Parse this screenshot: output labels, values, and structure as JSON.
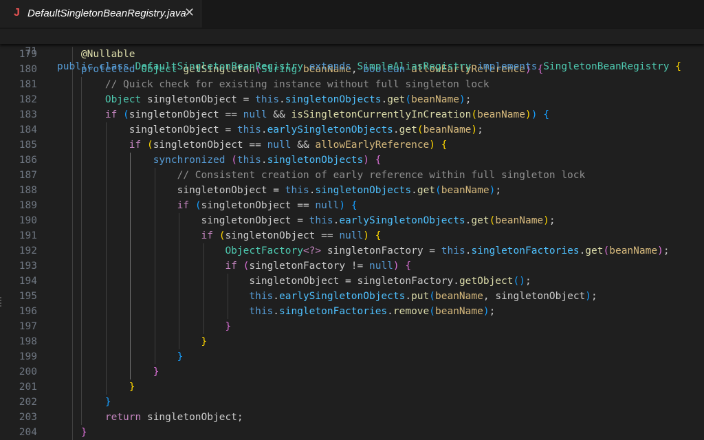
{
  "tab": {
    "icon": "J",
    "icon_color": "#e55353",
    "filename": "DefaultSingletonBeanRegistry.java",
    "close_glyph": "✕"
  },
  "sticky": {
    "line_no": "71",
    "tokens": [
      [
        "kw",
        "public"
      ],
      [
        "op",
        " "
      ],
      [
        "kw",
        "class"
      ],
      [
        "op",
        " "
      ],
      [
        "ty",
        "DefaultSingletonBeanRegistry"
      ],
      [
        "op",
        " "
      ],
      [
        "kw",
        "extends"
      ],
      [
        "op",
        " "
      ],
      [
        "ty",
        "SimpleAliasRegistry"
      ],
      [
        "op",
        " "
      ],
      [
        "kw",
        "implements"
      ],
      [
        "op",
        " "
      ],
      [
        "ty",
        "SingletonBeanRegistry"
      ],
      [
        "op",
        " "
      ],
      [
        "pal1",
        "{"
      ]
    ]
  },
  "lines": [
    {
      "n": "179",
      "t": [
        [
          "op",
          "    "
        ],
        [
          "an",
          "@Nullable"
        ]
      ]
    },
    {
      "n": "180",
      "t": [
        [
          "op",
          "    "
        ],
        [
          "kw",
          "protected"
        ],
        [
          "op",
          " "
        ],
        [
          "ty",
          "Object"
        ],
        [
          "op",
          " "
        ],
        [
          "fn",
          "getSingleton"
        ],
        [
          "pal2",
          "("
        ],
        [
          "ty",
          "String"
        ],
        [
          "op",
          " "
        ],
        [
          "par",
          "beanName"
        ],
        [
          "op",
          ", "
        ],
        [
          "kw",
          "boolean"
        ],
        [
          "op",
          " "
        ],
        [
          "par",
          "allowEarlyReference"
        ],
        [
          "pal2",
          ")"
        ],
        [
          "op",
          " "
        ],
        [
          "pal2",
          "{"
        ]
      ]
    },
    {
      "n": "181",
      "t": [
        [
          "op",
          "        "
        ],
        [
          "cm",
          "// Quick check for existing instance without full singleton lock"
        ]
      ]
    },
    {
      "n": "182",
      "t": [
        [
          "op",
          "        "
        ],
        [
          "ty",
          "Object"
        ],
        [
          "op",
          " "
        ],
        [
          "var",
          "singletonObject"
        ],
        [
          "op",
          " = "
        ],
        [
          "kw",
          "this"
        ],
        [
          "op",
          "."
        ],
        [
          "field",
          "singletonObjects"
        ],
        [
          "op",
          "."
        ],
        [
          "fn",
          "get"
        ],
        [
          "pal3",
          "("
        ],
        [
          "par",
          "beanName"
        ],
        [
          "pal3",
          ")"
        ],
        [
          "op",
          ";"
        ]
      ]
    },
    {
      "n": "183",
      "t": [
        [
          "op",
          "        "
        ],
        [
          "ctl",
          "if"
        ],
        [
          "op",
          " "
        ],
        [
          "pal3",
          "("
        ],
        [
          "var",
          "singletonObject"
        ],
        [
          "op",
          " == "
        ],
        [
          "kw",
          "null"
        ],
        [
          "op",
          " && "
        ],
        [
          "fn",
          "isSingletonCurrentlyInCreation"
        ],
        [
          "pal1",
          "("
        ],
        [
          "par",
          "beanName"
        ],
        [
          "pal1",
          ")"
        ],
        [
          "pal3",
          ")"
        ],
        [
          "op",
          " "
        ],
        [
          "pal3",
          "{"
        ]
      ]
    },
    {
      "n": "184",
      "t": [
        [
          "op",
          "            "
        ],
        [
          "var",
          "singletonObject"
        ],
        [
          "op",
          " = "
        ],
        [
          "kw",
          "this"
        ],
        [
          "op",
          "."
        ],
        [
          "field",
          "earlySingletonObjects"
        ],
        [
          "op",
          "."
        ],
        [
          "fn",
          "get"
        ],
        [
          "pal1",
          "("
        ],
        [
          "par",
          "beanName"
        ],
        [
          "pal1",
          ")"
        ],
        [
          "op",
          ";"
        ]
      ]
    },
    {
      "n": "185",
      "t": [
        [
          "op",
          "            "
        ],
        [
          "ctl",
          "if"
        ],
        [
          "op",
          " "
        ],
        [
          "pal1",
          "("
        ],
        [
          "var",
          "singletonObject"
        ],
        [
          "op",
          " == "
        ],
        [
          "kw",
          "null"
        ],
        [
          "op",
          " && "
        ],
        [
          "par",
          "allowEarlyReference"
        ],
        [
          "pal1",
          ")"
        ],
        [
          "op",
          " "
        ],
        [
          "pal1",
          "{"
        ]
      ]
    },
    {
      "n": "186",
      "t": [
        [
          "op",
          "                "
        ],
        [
          "kw",
          "synchronized"
        ],
        [
          "op",
          " "
        ],
        [
          "pal2",
          "("
        ],
        [
          "kw",
          "this"
        ],
        [
          "op",
          "."
        ],
        [
          "field",
          "singletonObjects"
        ],
        [
          "pal2",
          ")"
        ],
        [
          "op",
          " "
        ],
        [
          "pal2",
          "{"
        ]
      ]
    },
    {
      "n": "187",
      "t": [
        [
          "op",
          "                    "
        ],
        [
          "cm",
          "// Consistent creation of early reference within full singleton lock"
        ]
      ]
    },
    {
      "n": "188",
      "t": [
        [
          "op",
          "                    "
        ],
        [
          "var",
          "singletonObject"
        ],
        [
          "op",
          " = "
        ],
        [
          "kw",
          "this"
        ],
        [
          "op",
          "."
        ],
        [
          "field",
          "singletonObjects"
        ],
        [
          "op",
          "."
        ],
        [
          "fn",
          "get"
        ],
        [
          "pal3",
          "("
        ],
        [
          "par",
          "beanName"
        ],
        [
          "pal3",
          ")"
        ],
        [
          "op",
          ";"
        ]
      ]
    },
    {
      "n": "189",
      "t": [
        [
          "op",
          "                    "
        ],
        [
          "ctl",
          "if"
        ],
        [
          "op",
          " "
        ],
        [
          "pal3",
          "("
        ],
        [
          "var",
          "singletonObject"
        ],
        [
          "op",
          " == "
        ],
        [
          "kw",
          "null"
        ],
        [
          "pal3",
          ")"
        ],
        [
          "op",
          " "
        ],
        [
          "pal3",
          "{"
        ]
      ]
    },
    {
      "n": "190",
      "t": [
        [
          "op",
          "                        "
        ],
        [
          "var",
          "singletonObject"
        ],
        [
          "op",
          " = "
        ],
        [
          "kw",
          "this"
        ],
        [
          "op",
          "."
        ],
        [
          "field",
          "earlySingletonObjects"
        ],
        [
          "op",
          "."
        ],
        [
          "fn",
          "get"
        ],
        [
          "pal1",
          "("
        ],
        [
          "par",
          "beanName"
        ],
        [
          "pal1",
          ")"
        ],
        [
          "op",
          ";"
        ]
      ]
    },
    {
      "n": "191",
      "t": [
        [
          "op",
          "                        "
        ],
        [
          "ctl",
          "if"
        ],
        [
          "op",
          " "
        ],
        [
          "pal1",
          "("
        ],
        [
          "var",
          "singletonObject"
        ],
        [
          "op",
          " == "
        ],
        [
          "kw",
          "null"
        ],
        [
          "pal1",
          ")"
        ],
        [
          "op",
          " "
        ],
        [
          "pal1",
          "{"
        ]
      ]
    },
    {
      "n": "192",
      "t": [
        [
          "op",
          "                            "
        ],
        [
          "ty",
          "ObjectFactory"
        ],
        [
          "ctl",
          "<?>"
        ],
        [
          "op",
          " "
        ],
        [
          "var",
          "singletonFactory"
        ],
        [
          "op",
          " = "
        ],
        [
          "kw",
          "this"
        ],
        [
          "op",
          "."
        ],
        [
          "field",
          "singletonFactories"
        ],
        [
          "op",
          "."
        ],
        [
          "fn",
          "get"
        ],
        [
          "pal2",
          "("
        ],
        [
          "par",
          "beanName"
        ],
        [
          "pal2",
          ")"
        ],
        [
          "op",
          ";"
        ]
      ]
    },
    {
      "n": "193",
      "t": [
        [
          "op",
          "                            "
        ],
        [
          "ctl",
          "if"
        ],
        [
          "op",
          " "
        ],
        [
          "pal2",
          "("
        ],
        [
          "var",
          "singletonFactory"
        ],
        [
          "op",
          " != "
        ],
        [
          "kw",
          "null"
        ],
        [
          "pal2",
          ")"
        ],
        [
          "op",
          " "
        ],
        [
          "pal2",
          "{"
        ]
      ]
    },
    {
      "n": "194",
      "t": [
        [
          "op",
          "                                "
        ],
        [
          "var",
          "singletonObject"
        ],
        [
          "op",
          " = "
        ],
        [
          "var",
          "singletonFactory"
        ],
        [
          "op",
          "."
        ],
        [
          "fn",
          "getObject"
        ],
        [
          "pal3",
          "()"
        ],
        [
          "op",
          ";"
        ]
      ]
    },
    {
      "n": "195",
      "t": [
        [
          "op",
          "                                "
        ],
        [
          "kw",
          "this"
        ],
        [
          "op",
          "."
        ],
        [
          "field",
          "earlySingletonObjects"
        ],
        [
          "op",
          "."
        ],
        [
          "fn",
          "put"
        ],
        [
          "pal3",
          "("
        ],
        [
          "par",
          "beanName"
        ],
        [
          "op",
          ", "
        ],
        [
          "var",
          "singletonObject"
        ],
        [
          "pal3",
          ")"
        ],
        [
          "op",
          ";"
        ]
      ]
    },
    {
      "n": "196",
      "t": [
        [
          "op",
          "                                "
        ],
        [
          "kw",
          "this"
        ],
        [
          "op",
          "."
        ],
        [
          "field",
          "singletonFactories"
        ],
        [
          "op",
          "."
        ],
        [
          "fn",
          "remove"
        ],
        [
          "pal3",
          "("
        ],
        [
          "par",
          "beanName"
        ],
        [
          "pal3",
          ")"
        ],
        [
          "op",
          ";"
        ]
      ]
    },
    {
      "n": "197",
      "t": [
        [
          "op",
          "                            "
        ],
        [
          "pal2",
          "}"
        ]
      ]
    },
    {
      "n": "198",
      "t": [
        [
          "op",
          "                        "
        ],
        [
          "pal1",
          "}"
        ]
      ]
    },
    {
      "n": "199",
      "t": [
        [
          "op",
          "                    "
        ],
        [
          "pal3",
          "}"
        ]
      ]
    },
    {
      "n": "200",
      "t": [
        [
          "op",
          "                "
        ],
        [
          "pal2",
          "}"
        ]
      ]
    },
    {
      "n": "201",
      "t": [
        [
          "op",
          "            "
        ],
        [
          "pal1",
          "}"
        ]
      ]
    },
    {
      "n": "202",
      "t": [
        [
          "op",
          "        "
        ],
        [
          "pal3",
          "}"
        ]
      ]
    },
    {
      "n": "203",
      "t": [
        [
          "op",
          "        "
        ],
        [
          "ctl",
          "return"
        ],
        [
          "op",
          " "
        ],
        [
          "var",
          "singletonObject"
        ],
        [
          "op",
          ";"
        ]
      ]
    },
    {
      "n": "204",
      "t": [
        [
          "op",
          "    "
        ],
        [
          "pal2",
          "}"
        ]
      ]
    }
  ]
}
